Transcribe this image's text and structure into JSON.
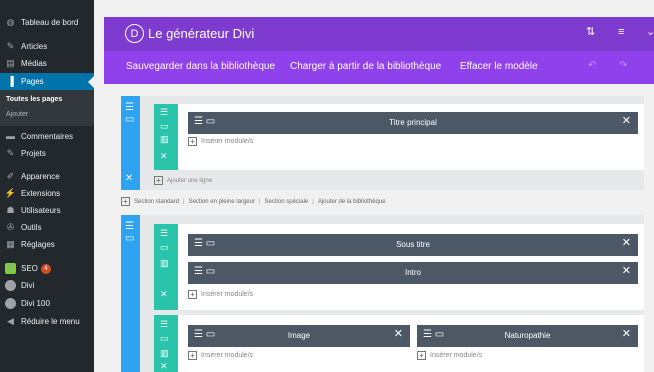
{
  "sidebar": {
    "items": [
      {
        "label": "Tableau de bord",
        "icon": "dashboard-icon",
        "glyph": "◍"
      },
      {
        "label": "Articles",
        "icon": "pin-icon",
        "glyph": "✎"
      },
      {
        "label": "Médias",
        "icon": "media-icon",
        "glyph": "▤"
      },
      {
        "label": "Pages",
        "icon": "pages-icon",
        "glyph": "▐"
      },
      {
        "label": "Commentaires",
        "icon": "comments-icon",
        "glyph": "▬"
      },
      {
        "label": "Projets",
        "icon": "pin-icon",
        "glyph": "✎"
      },
      {
        "label": "Apparence",
        "icon": "brush-icon",
        "glyph": "✐"
      },
      {
        "label": "Extensions",
        "icon": "plugin-icon",
        "glyph": "⚡"
      },
      {
        "label": "Utilisateurs",
        "icon": "user-icon",
        "glyph": "☗"
      },
      {
        "label": "Outils",
        "icon": "wrench-icon",
        "glyph": "✇"
      },
      {
        "label": "Réglages",
        "icon": "settings-icon",
        "glyph": "▦"
      },
      {
        "label": "SEO",
        "icon": "seo-icon",
        "glyph": "Y",
        "badge": "4"
      },
      {
        "label": "Divi",
        "icon": "divi-icon",
        "glyph": "D"
      },
      {
        "label": "Divi 100",
        "icon": "divi-icon",
        "glyph": "D"
      },
      {
        "label": "Réduire le menu",
        "icon": "collapse-icon",
        "glyph": "◀"
      }
    ],
    "submenu": [
      "Toutes les pages",
      "Ajouter"
    ]
  },
  "builder": {
    "logo": "D",
    "title": "Le générateur Divi",
    "actions": {
      "save_library": "Sauvegarder dans la bibliothèque",
      "load_library": "Charger à partir de la bibliothèque",
      "clear_layout": "Effacer le modèle"
    },
    "add_row": "Ajouter une ligne",
    "insert_module": "Insérer module/s",
    "section_links": [
      "Section standard",
      "Section en pleine largeur",
      "Section spéciale",
      "Ajouter de la bibliothèque"
    ],
    "section1": {
      "modules": [
        "Titre principal"
      ]
    },
    "section2": {
      "row1_modules": [
        "Sous titre",
        "Intro"
      ],
      "row2_col1": [
        "Image"
      ],
      "row2_col2": [
        "Naturopathie"
      ]
    }
  },
  "colors": {
    "admin_bg": "#23282d",
    "admin_active": "#0073aa",
    "builder_header": "#7e3bd0",
    "builder_toolbar": "#8f42ec",
    "section": "#2ea3f2",
    "row": "#29c4a9",
    "module": "#4c5866"
  }
}
